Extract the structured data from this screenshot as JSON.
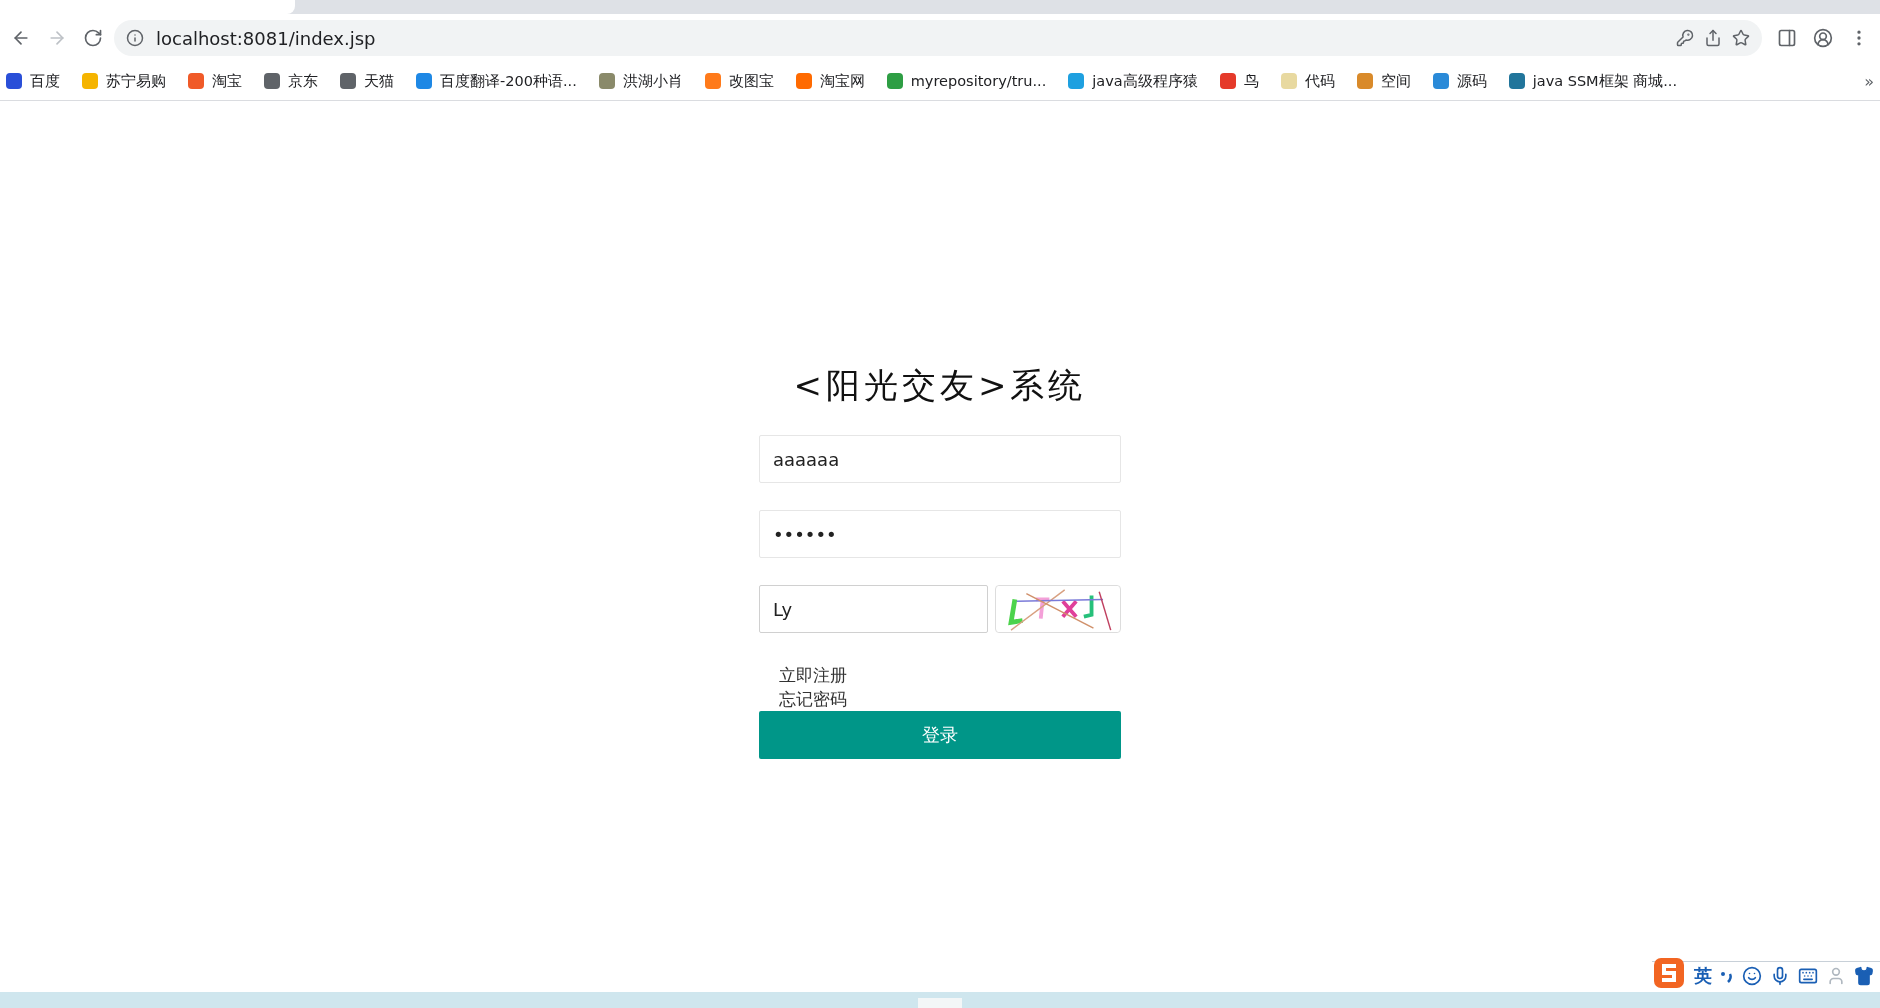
{
  "browser": {
    "forward_disabled": true,
    "url": "localhost:8081/index.jsp"
  },
  "bookmarks": [
    {
      "label": "百度",
      "color": "#2a4fd8"
    },
    {
      "label": "苏宁易购",
      "color": "#f5b400"
    },
    {
      "label": "淘宝",
      "color": "#f05a28"
    },
    {
      "label": "京东",
      "color": "#5f6368"
    },
    {
      "label": "天猫",
      "color": "#5f6368"
    },
    {
      "label": "百度翻译-200种语...",
      "color": "#1e88e5"
    },
    {
      "label": "洪湖小肖",
      "color": "#8a8a6a"
    },
    {
      "label": "改图宝",
      "color": "#ff7a1a"
    },
    {
      "label": "淘宝网",
      "color": "#ff6a00"
    },
    {
      "label": "myrepository/tru...",
      "color": "#2e9e44"
    },
    {
      "label": "java高级程序猿",
      "color": "#1ea0e0"
    },
    {
      "label": "鸟",
      "color": "#e53a2a"
    },
    {
      "label": "代码",
      "color": "#e8d9a0"
    },
    {
      "label": "空间",
      "color": "#d98a2a"
    },
    {
      "label": "源码",
      "color": "#2a8ad8"
    },
    {
      "label": "java SSM框架 商城...",
      "color": "#21759b"
    }
  ],
  "bookmarks_overflow": "»",
  "login": {
    "title": "<阳光交友>系统",
    "username": "aaaaaa",
    "password": "••••••",
    "captcha": "Ly",
    "links": [
      "立即注册",
      "忘记密码"
    ],
    "submit": "登录"
  },
  "ime": {
    "mode": "英"
  }
}
